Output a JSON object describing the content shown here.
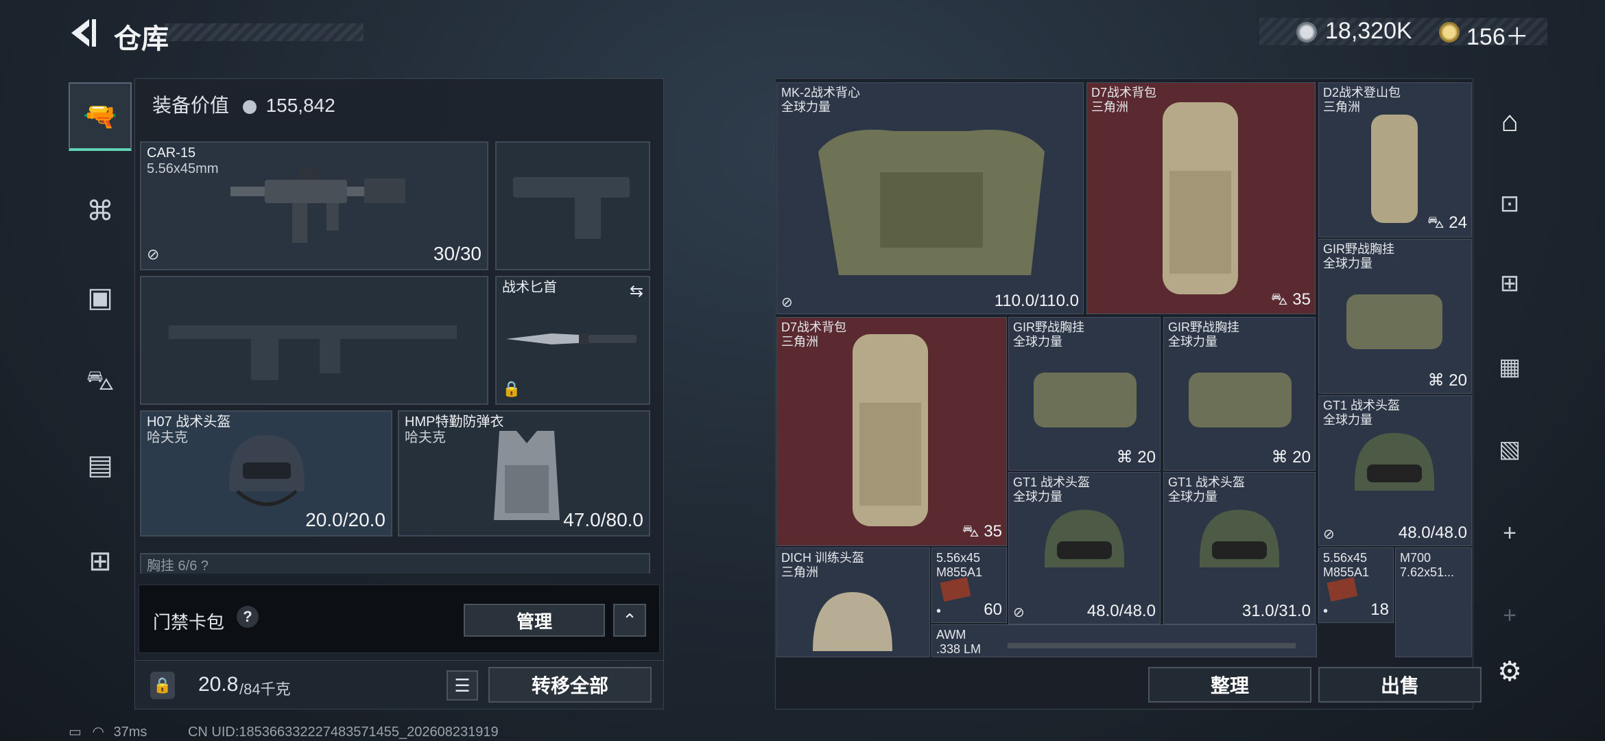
{
  "header": {
    "title": "仓库"
  },
  "currency": [
    {
      "value": "18,320K",
      "icon": "silver-coin-icon"
    },
    {
      "value": "156＋",
      "icon": "gold-coin-icon"
    }
  ],
  "loadout": {
    "value_label": "装备价值",
    "value": "155,842",
    "primary": {
      "name": "CAR-15",
      "ammo": "5.56x45mm",
      "durability": "30/30"
    },
    "melee": {
      "name": "战术匕首"
    },
    "helmet": {
      "name": "H07 战术头盔",
      "origin": "哈夫克",
      "durability": "20.0/20.0"
    },
    "armor": {
      "name": "HMP特勤防弹衣",
      "origin": "哈夫克",
      "durability": "47.0/80.0"
    },
    "chest_partial": "胸挂 6/6 ?",
    "keycard_label": "门禁卡包",
    "keycard_help": "?",
    "manage_label": "管理",
    "weight": "20.8",
    "weight_max": "/84千克",
    "transfer_label": "转移全部"
  },
  "stash": {
    "items": [
      {
        "name": "MK-2战术背心",
        "origin": "全球力量",
        "value": "110.0/110.0"
      },
      {
        "name": "D7战术背包",
        "origin": "三角洲",
        "value": "35"
      },
      {
        "name": "D2战术登山包",
        "origin": "三角洲",
        "value": "24"
      },
      {
        "name": "GIR野战胸挂",
        "origin": "全球力量",
        "value": "20"
      },
      {
        "name": "D7战术背包",
        "origin": "三角洲",
        "value": "35"
      },
      {
        "name": "GIR野战胸挂",
        "origin": "全球力量",
        "value": "20"
      },
      {
        "name": "GIR野战胸挂",
        "origin": "全球力量",
        "value": "20"
      },
      {
        "name": "GT1 战术头盔",
        "origin": "全球力量",
        "value": "48.0/48.0"
      },
      {
        "name": "GT1 战术头盔",
        "origin": "全球力量",
        "value": "48.0/48.0"
      },
      {
        "name": "GT1 战术头盔",
        "origin": "全球力量",
        "value": "31.0/31.0"
      },
      {
        "name": "DICH 训练头盔",
        "origin": "三角洲",
        "value": ""
      },
      {
        "name": "5.56x45",
        "origin": "M855A1",
        "value": "60"
      },
      {
        "name": "5.56x45",
        "origin": "M855A1",
        "value": "18"
      },
      {
        "name": "M700",
        "origin": "7.62x51...",
        "value": ""
      },
      {
        "name": "AWM",
        "origin": ".338 LM",
        "value": ""
      }
    ],
    "sort_label": "整理",
    "sell_label": "出售"
  },
  "status": {
    "ping": "37ms",
    "uid": "CN UID:185366332227483571455_202608231919"
  }
}
